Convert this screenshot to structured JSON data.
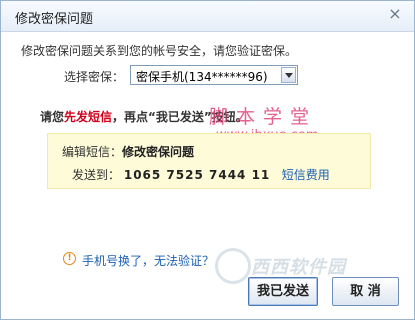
{
  "dialog": {
    "title": "修改密保问题",
    "close_glyph": "×",
    "description": "修改密保问题关系到您的帐号安全，请您验证密保。"
  },
  "verify": {
    "label": "选择密保：",
    "selected": "密保手机(134******96)"
  },
  "instruction": {
    "part1": "请您",
    "highlight": "先发短信",
    "part2": "，再点“我已发送”按钮。"
  },
  "watermark": {
    "chinese": "脚本学堂",
    "url": "www.jbxue.com",
    "logo_text": "西西软件园"
  },
  "sms": {
    "edit_label": "编辑短信：",
    "edit_value": "修改密保问题",
    "send_label": "发送到：",
    "send_number": "1065 7525 7444 11",
    "fee_link": "短信费用"
  },
  "help": {
    "icon": "!",
    "link": "手机号换了，无法验证？"
  },
  "buttons": {
    "sent": "我已发送",
    "cancel": "取 消"
  },
  "colors": {
    "accent_red": "#d0021b",
    "link_blue": "#1a5fb4",
    "sms_bg": "#fefbd9",
    "watermark_pink": "#e0457a"
  }
}
